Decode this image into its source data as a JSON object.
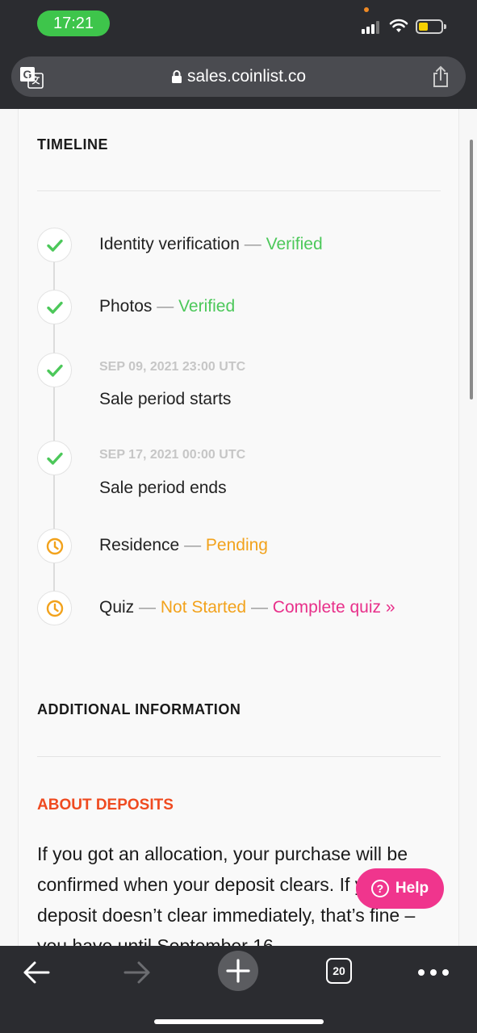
{
  "status_bar": {
    "time": "17:21"
  },
  "browser": {
    "url": "sales.coinlist.co",
    "tab_count": "20"
  },
  "timeline": {
    "title": "TIMELINE",
    "items": [
      {
        "label": "Identity verification",
        "sep": "—",
        "status": "Verified",
        "state": "done"
      },
      {
        "label": "Photos",
        "sep": "—",
        "status": "Verified",
        "state": "done"
      },
      {
        "date": "SEP 09, 2021 23:00 UTC",
        "label": "Sale period starts",
        "state": "done"
      },
      {
        "date": "SEP 17, 2021 00:00 UTC",
        "label": "Sale period ends",
        "state": "done"
      },
      {
        "label": "Residence",
        "sep": "—",
        "status": "Pending",
        "state": "pending"
      },
      {
        "label": "Quiz",
        "sep": "—",
        "status": "Not Started",
        "sep2": "—",
        "action": "Complete quiz »",
        "state": "pending"
      }
    ]
  },
  "additional": {
    "title": "ADDITIONAL INFORMATION"
  },
  "deposits": {
    "title": "ABOUT DEPOSITS",
    "text": "If you got an allocation, your purchase will be confirmed when your deposit clears. If your deposit doesn’t clear immediately, that’s fine – you have until September 16"
  },
  "help": {
    "label": "Help"
  },
  "colors": {
    "verified": "#4cc85a",
    "pending": "#f2a21c",
    "link": "#e8308a",
    "accent": "#ef4a20",
    "help_bg": "#f0358d"
  }
}
